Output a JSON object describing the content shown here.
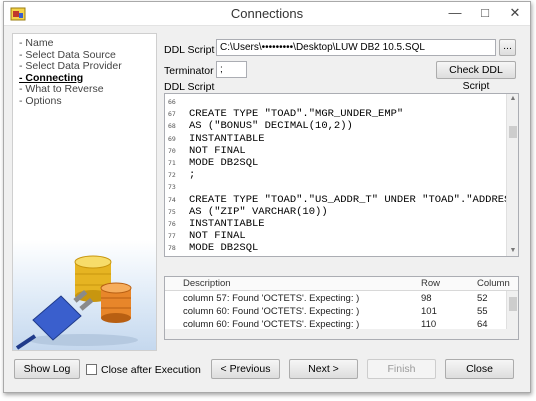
{
  "window": {
    "title": "Connections"
  },
  "steps": [
    "- Name",
    "- Select Data Source",
    "- Select Data Provider",
    "- Connecting",
    "- What to Reverse",
    "- Options"
  ],
  "active_step_index": 3,
  "form": {
    "ddl_script_label": "DDL Script",
    "ddl_script_value": "C:\\Users\\•••••••••\\Desktop\\LUW DB2 10.5.SQL",
    "browse_label": "...",
    "terminator_label": "Terminator",
    "terminator_value": ";",
    "check_button": "Check DDL Script",
    "section_label": "DDL Script"
  },
  "code_lines": [
    {
      "n": "66",
      "text": ""
    },
    {
      "n": "67",
      "text": "CREATE TYPE \"TOAD\".\"MGR_UNDER_EMP\""
    },
    {
      "n": "68",
      "text": " AS (\"BONUS\" DECIMAL(10,2))"
    },
    {
      "n": "69",
      "text": "INSTANTIABLE"
    },
    {
      "n": "70",
      "text": "NOT FINAL"
    },
    {
      "n": "71",
      "text": "MODE DB2SQL"
    },
    {
      "n": "72",
      "text": ";"
    },
    {
      "n": "73",
      "text": ""
    },
    {
      "n": "74",
      "text": "CREATE TYPE \"TOAD\".\"US_ADDR_T\" UNDER \"TOAD\".\"ADDRESS_"
    },
    {
      "n": "75",
      "text": " AS (\"ZIP\" VARCHAR(10))"
    },
    {
      "n": "76",
      "text": "INSTANTIABLE"
    },
    {
      "n": "77",
      "text": "NOT FINAL"
    },
    {
      "n": "78",
      "text": "MODE DB2SQL"
    }
  ],
  "grid": {
    "headers": {
      "description": "Description",
      "row": "Row",
      "column": "Column"
    },
    "rows": [
      {
        "description": "column 57: Found 'OCTETS'. Expecting: )",
        "row": "98",
        "column": "52"
      },
      {
        "description": "column 60: Found 'OCTETS'. Expecting: )",
        "row": "101",
        "column": "55"
      },
      {
        "description": "column 60: Found 'OCTETS'. Expecting: )",
        "row": "110",
        "column": "64"
      }
    ]
  },
  "footer": {
    "show_log": "Show Log",
    "close_after": "Close after Execution",
    "previous": "< Previous",
    "next": "Next >",
    "finish": "Finish",
    "close": "Close"
  },
  "colors": {
    "accent": "#c0392b",
    "disk_yellow": "#f2c230",
    "disk_orange": "#e8862a",
    "plug_blue": "#3a5fcd"
  }
}
